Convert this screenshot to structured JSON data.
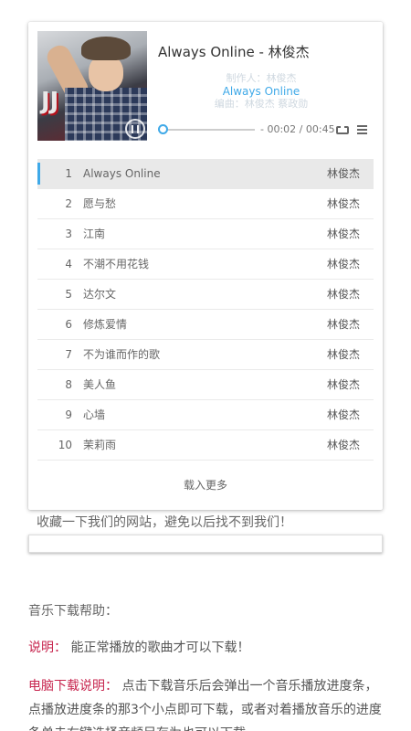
{
  "player": {
    "title": "Always Online - 林俊杰",
    "lyrics": {
      "previous": "制作人：林俊杰",
      "current": "Always Online",
      "next": "编曲：林俊杰 蔡政勋"
    },
    "progress": {
      "current_time": "00:02",
      "total_time": "00:45",
      "time_display": "- 00:02 / 00:45",
      "played_fraction": 0.04
    },
    "icons": {
      "play": "pause-icon",
      "loop": "loop-icon",
      "menu": "menu-icon"
    },
    "colors": {
      "accent": "#3fa9e8",
      "active_row": "#e9e9e9"
    }
  },
  "playlist": [
    {
      "index": "1",
      "name": "Always Online",
      "artist": "林俊杰",
      "active": true
    },
    {
      "index": "2",
      "name": "愿与愁",
      "artist": "林俊杰"
    },
    {
      "index": "3",
      "name": "江南",
      "artist": "林俊杰"
    },
    {
      "index": "4",
      "name": "不潮不用花钱",
      "artist": "林俊杰"
    },
    {
      "index": "5",
      "name": "达尔文",
      "artist": "林俊杰"
    },
    {
      "index": "6",
      "name": "修炼爱情",
      "artist": "林俊杰"
    },
    {
      "index": "7",
      "name": "不为谁而作的歌",
      "artist": "林俊杰"
    },
    {
      "index": "8",
      "name": "美人鱼",
      "artist": "林俊杰"
    },
    {
      "index": "9",
      "name": "心墙",
      "artist": "林俊杰"
    },
    {
      "index": "10",
      "name": "茉莉雨",
      "artist": "林俊杰"
    }
  ],
  "load_more": "载入更多",
  "bookmark_tip": "收藏一下我们的网站，避免以后找不到我们！",
  "help": {
    "title": "音乐下载帮助：",
    "note_label": "说明：",
    "note_text": "能正常播放的歌曲才可以下载！",
    "pc_label": "电脑下载说明：",
    "pc_text": "点击下载音乐后会弹出一个音乐播放进度条，点播放进度条的那3个小点即可下载，或者对着播放音乐的进度条单击右键选择音频另存为也可以下载"
  }
}
